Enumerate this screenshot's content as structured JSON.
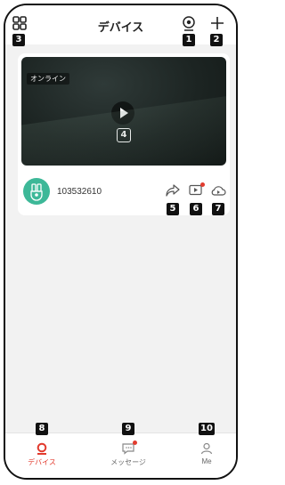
{
  "header": {
    "title": "デバイス"
  },
  "device": {
    "status": "オンライン",
    "name": "103532610"
  },
  "nav": {
    "devices": "デバイス",
    "messages": "メッセージ",
    "me": "Me"
  },
  "markers": [
    "1",
    "2",
    "3",
    "4",
    "5",
    "6",
    "7",
    "8",
    "9",
    "10"
  ],
  "colors": {
    "accent": "#e23b2e",
    "avatar": "#3db898"
  }
}
